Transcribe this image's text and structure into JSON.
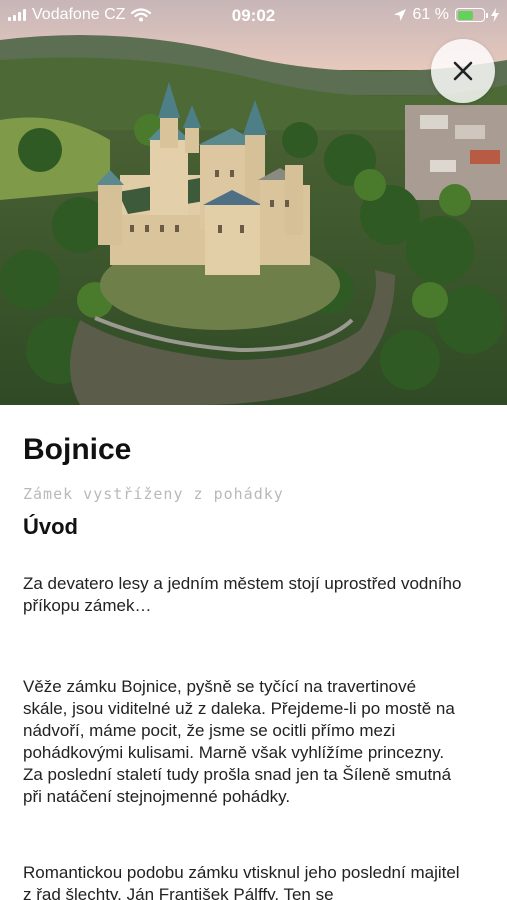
{
  "status_bar": {
    "carrier": "Vodafone CZ",
    "time": "09:02",
    "battery_percent_label": "61 %",
    "battery_level": 0.61
  },
  "hero": {
    "image_subject": "Bojnice castle aerial photo"
  },
  "close_button": {
    "icon": "close-icon"
  },
  "article": {
    "title": "Bojnice",
    "subtitle": "Zámek vystříženy z pohádky",
    "section_heading": "Úvod",
    "paragraphs": [
      "Za devatero lesy a jedním městem stojí uprostřed vodního příkopu zámek…",
      "Věže zámku Bojnice, pyšně se tyčící na travertinové skále, jsou viditelné už z daleka. Přejdeme-li po mostě na nádvoří, máme pocit, že jsme se ocitli přímo mezi pohádkovými kulisami. Marně však vyhlížíme princezny. Za poslední staletí tudy prošla snad jen ta Šíleně smutná při natáčení stejnojmenné pohádky.",
      "Romantickou podobu zámku vtisknul jeho poslední majitel z řad šlechty, Ján František Pálffy. Ten se"
    ]
  },
  "colors": {
    "battery_green": "#66d05c",
    "subtitle_gray": "#b9b9b9",
    "text": "#111111"
  }
}
